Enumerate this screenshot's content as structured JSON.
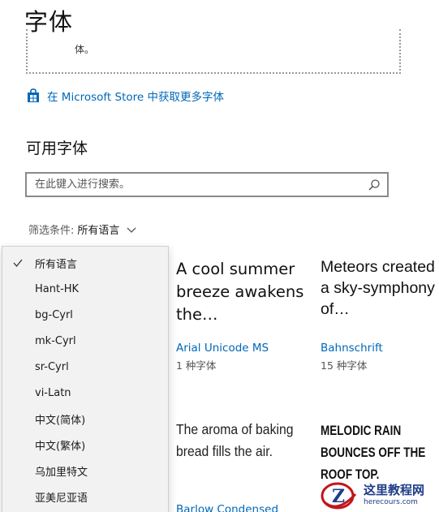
{
  "header": {
    "title": "字体"
  },
  "drop_zone": {
    "text": "体。"
  },
  "store_link": {
    "label": "在 Microsoft Store 中获取更多字体"
  },
  "available": {
    "title": "可用字体"
  },
  "search": {
    "placeholder": "在此键入进行搜索。"
  },
  "filter": {
    "label": "筛选条件:",
    "value": "所有语言"
  },
  "dropdown": {
    "items": [
      {
        "label": "所有语言",
        "selected": true
      },
      {
        "label": "Hant-HK",
        "selected": false
      },
      {
        "label": "bg-Cyrl",
        "selected": false
      },
      {
        "label": "mk-Cyrl",
        "selected": false
      },
      {
        "label": "sr-Cyrl",
        "selected": false
      },
      {
        "label": "vi-Latn",
        "selected": false
      },
      {
        "label": "中文(简体)",
        "selected": false
      },
      {
        "label": "中文(繁体)",
        "selected": false
      },
      {
        "label": "乌加里特文",
        "selected": false
      },
      {
        "label": "亚美尼亚语",
        "selected": false
      }
    ]
  },
  "fonts": [
    {
      "preview": "A cool summer breeze awakens the…",
      "name": "Arial Unicode MS",
      "count": "1 种字体"
    },
    {
      "preview": "Meteors created a sky-symphony of…",
      "name": "Bahnschrift",
      "count": "15 种字体"
    },
    {
      "preview": "The aroma of baking bread fills the air.",
      "name": "Barlow Condensed",
      "count": ""
    },
    {
      "preview": "MELODIC RAIN BOUNCES OFF THE ROOF TOP.",
      "name": "",
      "count": ""
    }
  ],
  "watermark": {
    "title": "这里教程网",
    "url": "herecours.com"
  },
  "colors": {
    "link": "#0067b8",
    "dropdown_bg": "#f2f2f2",
    "watermark": "#1f3c88"
  },
  "icons": {
    "store": "store-bag-icon",
    "search": "search-icon",
    "chevron": "chevron-down-icon",
    "check": "checkmark-icon"
  }
}
